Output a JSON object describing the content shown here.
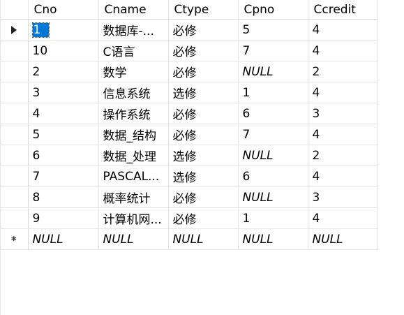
{
  "columns": [
    "Cno",
    "Cname",
    "Ctype",
    "Cpno",
    "Ccredit"
  ],
  "rows": [
    {
      "Cno": "1",
      "Cname": "数据库-...",
      "Ctype": "必修",
      "Cpno": "5",
      "Ccredit": "4"
    },
    {
      "Cno": "10",
      "Cname": "C语言",
      "Ctype": "必修",
      "Cpno": "7",
      "Ccredit": "4"
    },
    {
      "Cno": "2",
      "Cname": "数学",
      "Ctype": "必修",
      "Cpno": "NULL",
      "Ccredit": "2"
    },
    {
      "Cno": "3",
      "Cname": "信息系统",
      "Ctype": "选修",
      "Cpno": "1",
      "Ccredit": "4"
    },
    {
      "Cno": "4",
      "Cname": "操作系统",
      "Ctype": "必修",
      "Cpno": "6",
      "Ccredit": "3"
    },
    {
      "Cno": "5",
      "Cname": "数据_结构",
      "Ctype": "必修",
      "Cpno": "7",
      "Ccredit": "4"
    },
    {
      "Cno": "6",
      "Cname": "数据_处理",
      "Ctype": "选修",
      "Cpno": "NULL",
      "Ccredit": "2"
    },
    {
      "Cno": "7",
      "Cname": "PASCAL...",
      "Ctype": "选修",
      "Cpno": "6",
      "Ccredit": "4"
    },
    {
      "Cno": "8",
      "Cname": "概率统计",
      "Ctype": "必修",
      "Cpno": "NULL",
      "Ccredit": "3"
    },
    {
      "Cno": "9",
      "Cname": "计算机网...",
      "Ctype": "必修",
      "Cpno": "1",
      "Ccredit": "4"
    }
  ],
  "new_row": {
    "Cno": "NULL",
    "Cname": "NULL",
    "Ctype": "NULL",
    "Cpno": "NULL",
    "Ccredit": "NULL"
  },
  "current_row_indicator": "arrow-icon",
  "new_row_indicator": "*",
  "selection": {
    "row": 0,
    "column": "Cno",
    "color": "#0078d7"
  }
}
